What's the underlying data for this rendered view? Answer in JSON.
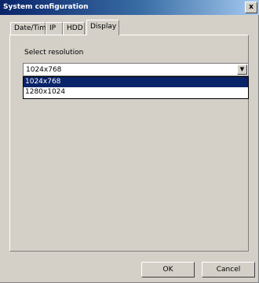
{
  "window": {
    "title": "System configuration",
    "close_glyph": "x"
  },
  "tabs": [
    {
      "label": "Date/Time"
    },
    {
      "label": "IP"
    },
    {
      "label": "HDD"
    },
    {
      "label": "Display"
    }
  ],
  "active_tab": "Display",
  "resolution": {
    "label": "Select resolution",
    "value": "1024x768",
    "arrow_glyph": "▼",
    "options": [
      "1024x768",
      "1280x1024"
    ],
    "highlighted": "1024x768"
  },
  "buttons": {
    "ok": "OK",
    "cancel": "Cancel"
  },
  "colors": {
    "titlebar": "#0a246a",
    "face": "#d4d0c8",
    "highlight": "#0a246a"
  }
}
